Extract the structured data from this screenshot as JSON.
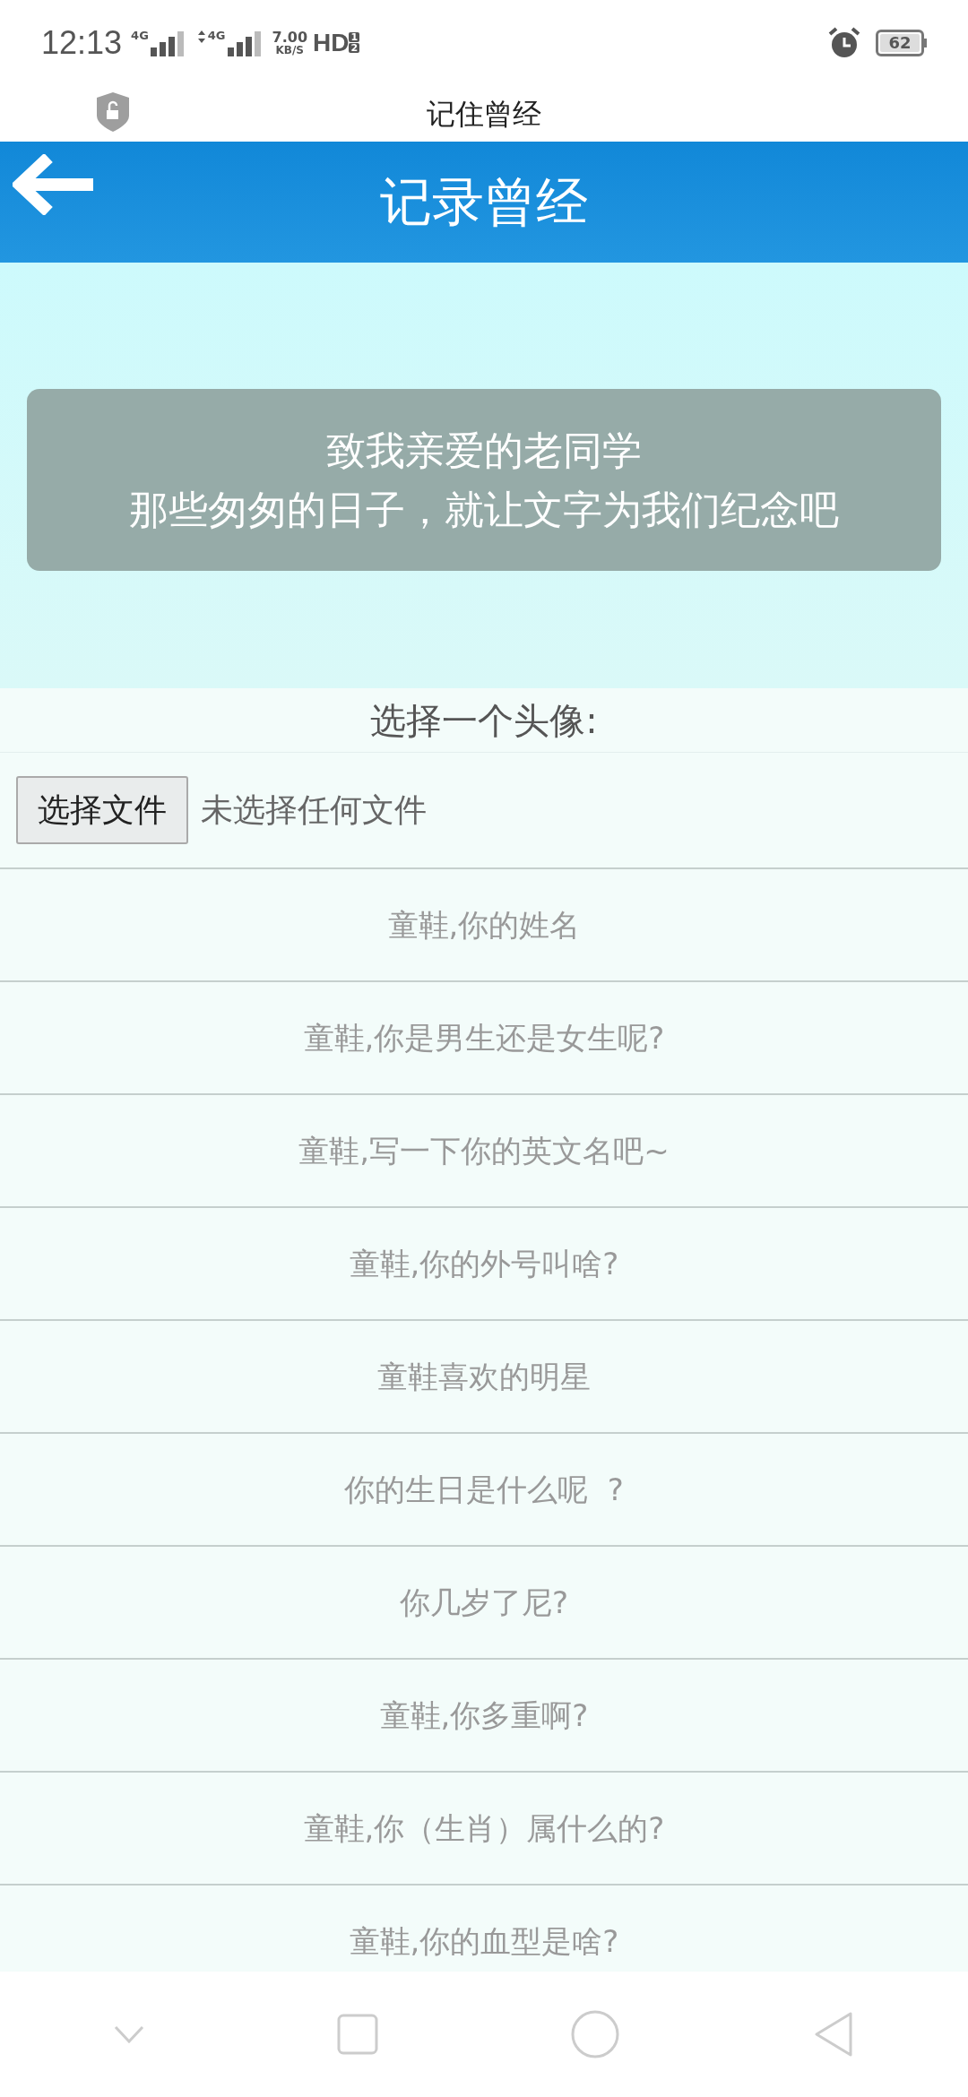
{
  "status_bar": {
    "time": "12:13",
    "sim_1": "4G",
    "sim_2": "4G",
    "speed": "7.00",
    "speed_unit": "KB/S",
    "hd": "HD",
    "hd_slots": [
      "1",
      "2"
    ],
    "battery": "62"
  },
  "browser_bar": {
    "title": "记住曾经"
  },
  "header": {
    "title": "记录曾经"
  },
  "banner": {
    "lines": [
      "致我亲爱的老同学",
      "那些匆匆的日子，就让文字为我们纪念吧"
    ]
  },
  "avatar": {
    "label": "选择一个头像:",
    "button": "选择文件",
    "file_status": "未选择任何文件"
  },
  "fields": [
    {
      "placeholder": "童鞋,你的姓名"
    },
    {
      "placeholder": "童鞋,你是男生还是女生呢?"
    },
    {
      "placeholder": "童鞋,写一下你的英文名吧~"
    },
    {
      "placeholder": "童鞋,你的外号叫啥?"
    },
    {
      "placeholder": "童鞋喜欢的明星"
    },
    {
      "placeholder": "你的生日是什么呢  ?"
    },
    {
      "placeholder": "你几岁了尼?"
    },
    {
      "placeholder": "童鞋,你多重啊?"
    },
    {
      "placeholder": "童鞋,你（生肖）属什么的?"
    },
    {
      "placeholder": "童鞋,你的血型是啥?"
    }
  ]
}
